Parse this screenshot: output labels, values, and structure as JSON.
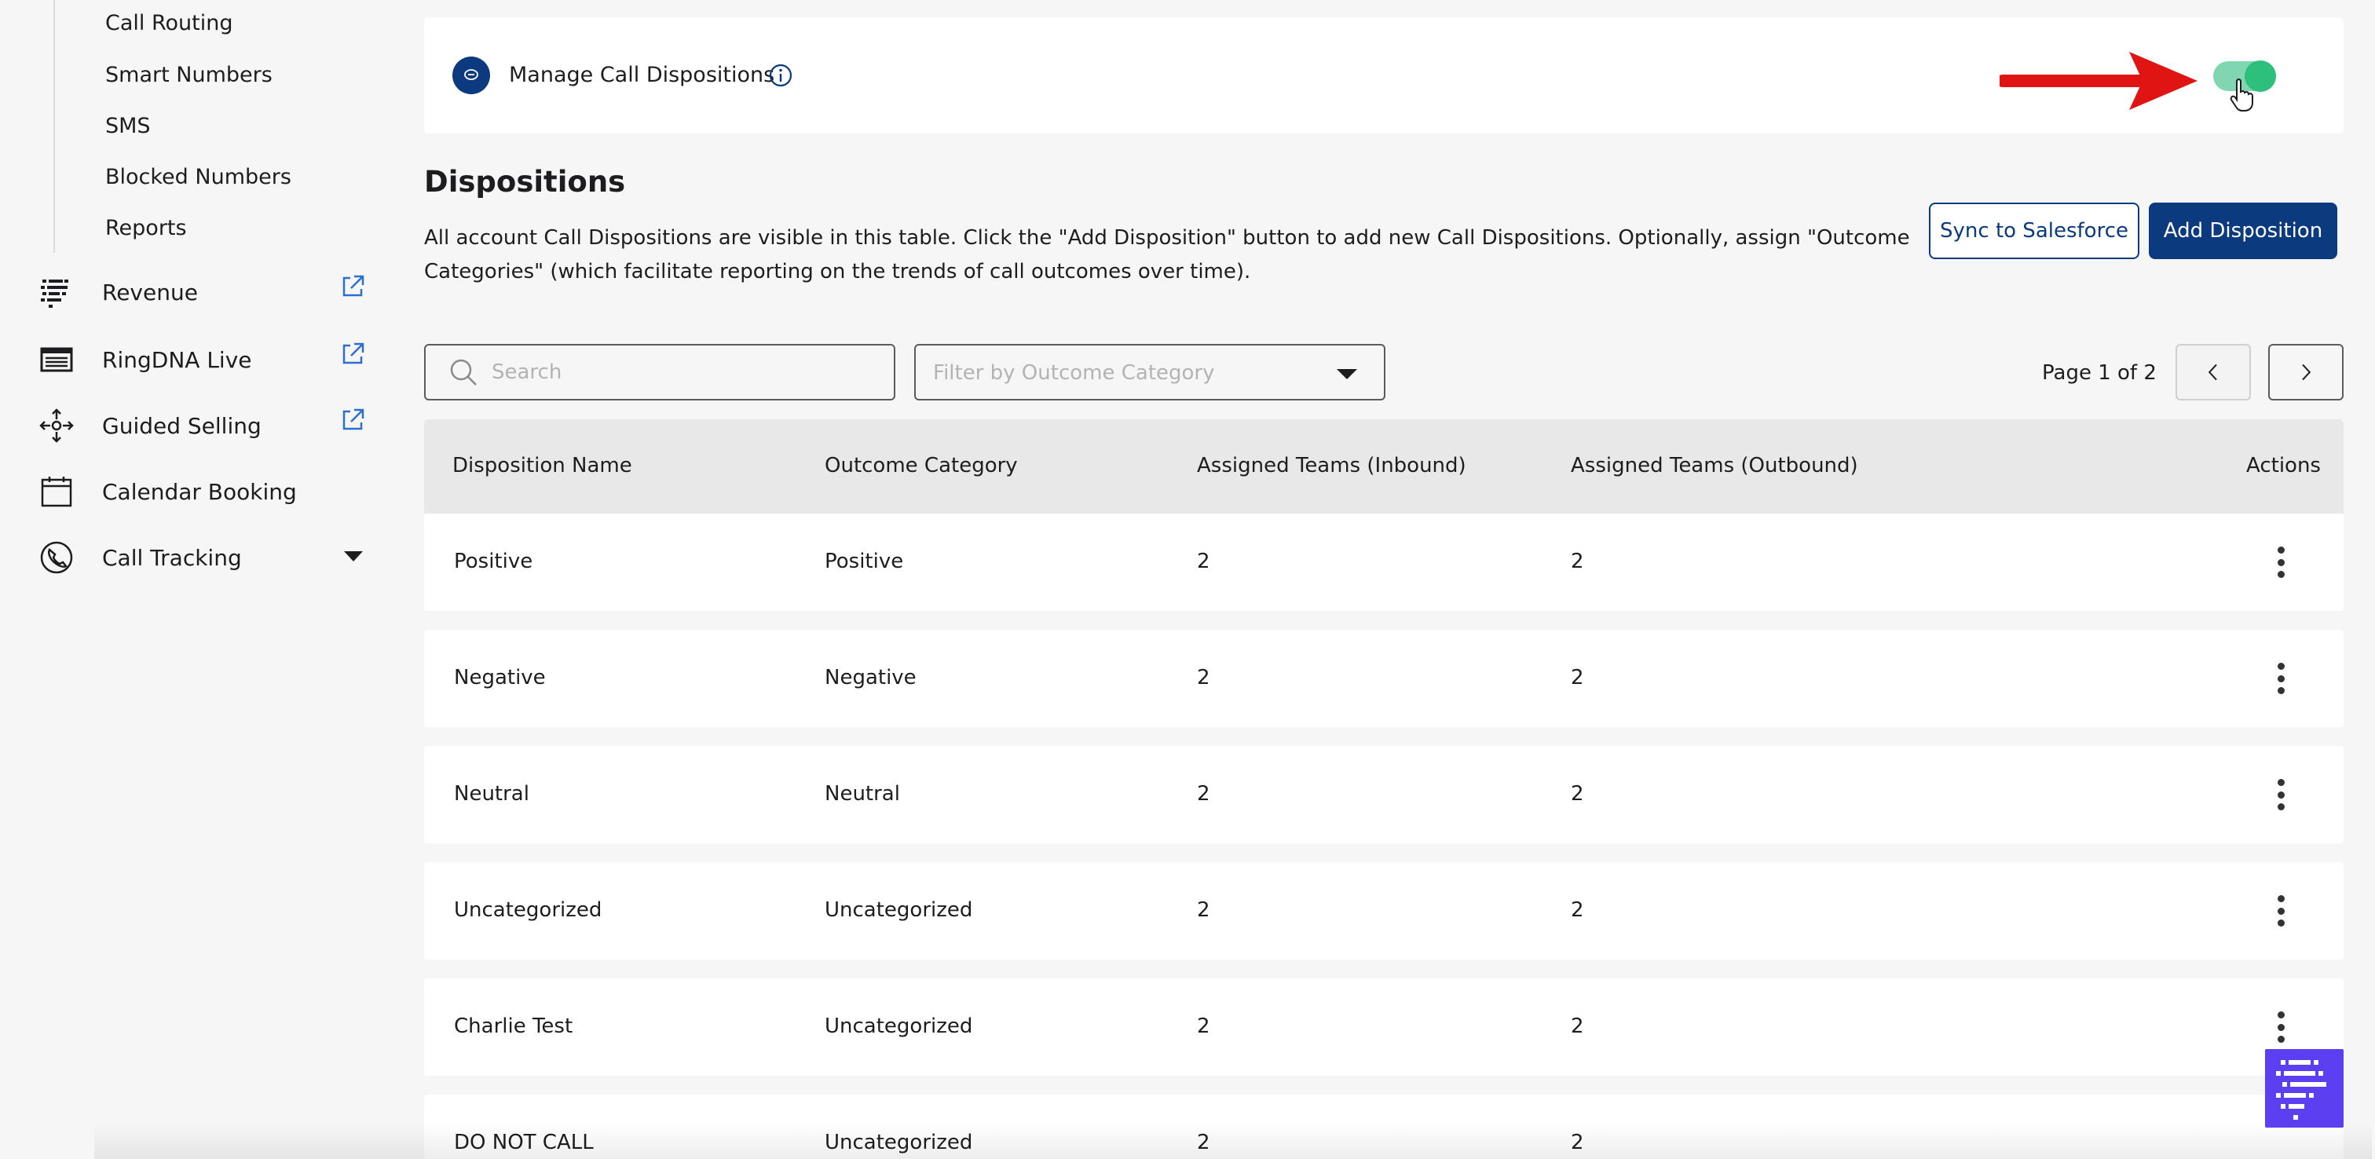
{
  "sidebar": {
    "sub_items": [
      "Call Routing",
      "Smart Numbers",
      "SMS",
      "Blocked Numbers",
      "Reports"
    ],
    "nav": [
      {
        "label": "Revenue",
        "icon": "revenue-icon",
        "external": true
      },
      {
        "label": "RingDNA Live",
        "icon": "live-icon",
        "external": true
      },
      {
        "label": "Guided Selling",
        "icon": "guided-selling-icon",
        "external": true
      },
      {
        "label": "Calendar Booking",
        "icon": "calendar-icon",
        "external": false
      },
      {
        "label": "Call Tracking",
        "icon": "call-tracking-icon",
        "expandable": true
      }
    ]
  },
  "toggle_card": {
    "title": "Manage Call Dispositions",
    "enabled": true,
    "accent_color": "#2fbf7c",
    "annotation_arrow_color": "#e11414"
  },
  "section": {
    "title": "Dispositions",
    "description": "All account Call Dispositions are visible in this table. Click the \"Add Disposition\" button to add new Call Dispositions. Optionally, assign \"Outcome Categories\" (which facilitate reporting on the trends of call outcomes over time).",
    "sync_label": "Sync to Salesforce",
    "add_label": "Add Disposition",
    "brand_color": "#0b3a7e"
  },
  "filters": {
    "search_placeholder": "Search",
    "category_placeholder": "Filter by Outcome Category"
  },
  "pagination": {
    "label": "Page 1 of 2"
  },
  "table": {
    "headers": [
      "Disposition Name",
      "Outcome Category",
      "Assigned Teams (Inbound)",
      "Assigned Teams (Outbound)",
      "Actions"
    ],
    "rows": [
      {
        "name": "Positive",
        "category": "Positive",
        "inbound": "2",
        "outbound": "2"
      },
      {
        "name": "Negative",
        "category": "Negative",
        "inbound": "2",
        "outbound": "2"
      },
      {
        "name": "Neutral",
        "category": "Neutral",
        "inbound": "2",
        "outbound": "2"
      },
      {
        "name": "Uncategorized",
        "category": "Uncategorized",
        "inbound": "2",
        "outbound": "2"
      },
      {
        "name": "Charlie Test",
        "category": "Uncategorized",
        "inbound": "2",
        "outbound": "2"
      },
      {
        "name": "DO NOT CALL",
        "category": "Uncategorized",
        "inbound": "2",
        "outbound": "2"
      }
    ]
  }
}
